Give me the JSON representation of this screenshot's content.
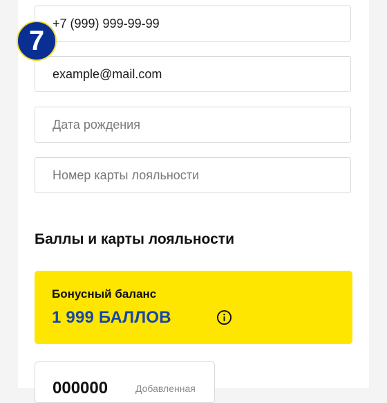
{
  "form": {
    "phone": {
      "value": "+7 (999) 999-99-99",
      "placeholder": ""
    },
    "email": {
      "value": "example@mail.com",
      "placeholder": ""
    },
    "birth_date": {
      "value": "",
      "placeholder": "Дата рождения"
    },
    "loyalty_card_number": {
      "value": "",
      "placeholder": "Номер карты лояльности"
    }
  },
  "step_badge": {
    "label": "7"
  },
  "loyalty_section": {
    "title": "Баллы и карты лояльности",
    "bonus": {
      "label": "Бонусный баланс",
      "value": "1 999 БАЛЛОВ",
      "info_icon": "info-icon"
    },
    "cards": [
      {
        "number": "000000",
        "status": "Добавленная"
      }
    ]
  },
  "colors": {
    "accent_yellow": "#ffe600",
    "accent_blue": "#1647a8",
    "badge_blue": "#0a2f93"
  }
}
